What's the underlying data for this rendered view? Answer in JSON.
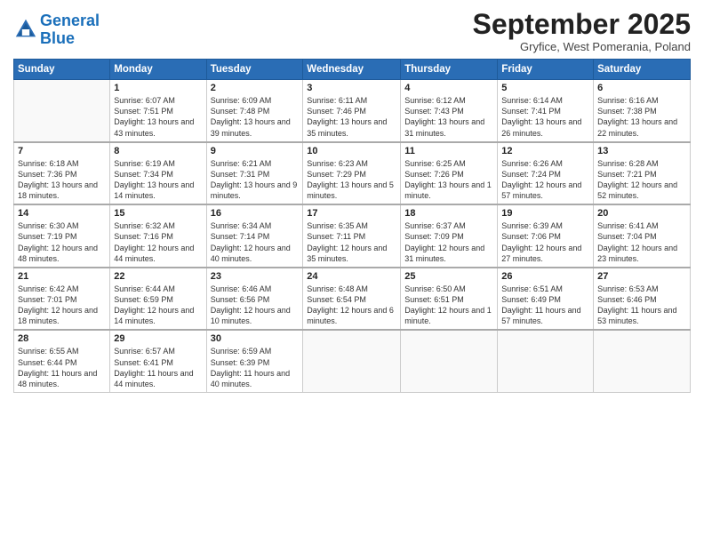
{
  "header": {
    "logo_line1": "General",
    "logo_line2": "Blue",
    "month_title": "September 2025",
    "subtitle": "Gryfice, West Pomerania, Poland"
  },
  "weekdays": [
    "Sunday",
    "Monday",
    "Tuesday",
    "Wednesday",
    "Thursday",
    "Friday",
    "Saturday"
  ],
  "weeks": [
    [
      {
        "day": "",
        "sunrise": "",
        "sunset": "",
        "daylight": "",
        "empty": true
      },
      {
        "day": "1",
        "sunrise": "Sunrise: 6:07 AM",
        "sunset": "Sunset: 7:51 PM",
        "daylight": "Daylight: 13 hours and 43 minutes."
      },
      {
        "day": "2",
        "sunrise": "Sunrise: 6:09 AM",
        "sunset": "Sunset: 7:48 PM",
        "daylight": "Daylight: 13 hours and 39 minutes."
      },
      {
        "day": "3",
        "sunrise": "Sunrise: 6:11 AM",
        "sunset": "Sunset: 7:46 PM",
        "daylight": "Daylight: 13 hours and 35 minutes."
      },
      {
        "day": "4",
        "sunrise": "Sunrise: 6:12 AM",
        "sunset": "Sunset: 7:43 PM",
        "daylight": "Daylight: 13 hours and 31 minutes."
      },
      {
        "day": "5",
        "sunrise": "Sunrise: 6:14 AM",
        "sunset": "Sunset: 7:41 PM",
        "daylight": "Daylight: 13 hours and 26 minutes."
      },
      {
        "day": "6",
        "sunrise": "Sunrise: 6:16 AM",
        "sunset": "Sunset: 7:38 PM",
        "daylight": "Daylight: 13 hours and 22 minutes."
      }
    ],
    [
      {
        "day": "7",
        "sunrise": "Sunrise: 6:18 AM",
        "sunset": "Sunset: 7:36 PM",
        "daylight": "Daylight: 13 hours and 18 minutes."
      },
      {
        "day": "8",
        "sunrise": "Sunrise: 6:19 AM",
        "sunset": "Sunset: 7:34 PM",
        "daylight": "Daylight: 13 hours and 14 minutes."
      },
      {
        "day": "9",
        "sunrise": "Sunrise: 6:21 AM",
        "sunset": "Sunset: 7:31 PM",
        "daylight": "Daylight: 13 hours and 9 minutes."
      },
      {
        "day": "10",
        "sunrise": "Sunrise: 6:23 AM",
        "sunset": "Sunset: 7:29 PM",
        "daylight": "Daylight: 13 hours and 5 minutes."
      },
      {
        "day": "11",
        "sunrise": "Sunrise: 6:25 AM",
        "sunset": "Sunset: 7:26 PM",
        "daylight": "Daylight: 13 hours and 1 minute."
      },
      {
        "day": "12",
        "sunrise": "Sunrise: 6:26 AM",
        "sunset": "Sunset: 7:24 PM",
        "daylight": "Daylight: 12 hours and 57 minutes."
      },
      {
        "day": "13",
        "sunrise": "Sunrise: 6:28 AM",
        "sunset": "Sunset: 7:21 PM",
        "daylight": "Daylight: 12 hours and 52 minutes."
      }
    ],
    [
      {
        "day": "14",
        "sunrise": "Sunrise: 6:30 AM",
        "sunset": "Sunset: 7:19 PM",
        "daylight": "Daylight: 12 hours and 48 minutes."
      },
      {
        "day": "15",
        "sunrise": "Sunrise: 6:32 AM",
        "sunset": "Sunset: 7:16 PM",
        "daylight": "Daylight: 12 hours and 44 minutes."
      },
      {
        "day": "16",
        "sunrise": "Sunrise: 6:34 AM",
        "sunset": "Sunset: 7:14 PM",
        "daylight": "Daylight: 12 hours and 40 minutes."
      },
      {
        "day": "17",
        "sunrise": "Sunrise: 6:35 AM",
        "sunset": "Sunset: 7:11 PM",
        "daylight": "Daylight: 12 hours and 35 minutes."
      },
      {
        "day": "18",
        "sunrise": "Sunrise: 6:37 AM",
        "sunset": "Sunset: 7:09 PM",
        "daylight": "Daylight: 12 hours and 31 minutes."
      },
      {
        "day": "19",
        "sunrise": "Sunrise: 6:39 AM",
        "sunset": "Sunset: 7:06 PM",
        "daylight": "Daylight: 12 hours and 27 minutes."
      },
      {
        "day": "20",
        "sunrise": "Sunrise: 6:41 AM",
        "sunset": "Sunset: 7:04 PM",
        "daylight": "Daylight: 12 hours and 23 minutes."
      }
    ],
    [
      {
        "day": "21",
        "sunrise": "Sunrise: 6:42 AM",
        "sunset": "Sunset: 7:01 PM",
        "daylight": "Daylight: 12 hours and 18 minutes."
      },
      {
        "day": "22",
        "sunrise": "Sunrise: 6:44 AM",
        "sunset": "Sunset: 6:59 PM",
        "daylight": "Daylight: 12 hours and 14 minutes."
      },
      {
        "day": "23",
        "sunrise": "Sunrise: 6:46 AM",
        "sunset": "Sunset: 6:56 PM",
        "daylight": "Daylight: 12 hours and 10 minutes."
      },
      {
        "day": "24",
        "sunrise": "Sunrise: 6:48 AM",
        "sunset": "Sunset: 6:54 PM",
        "daylight": "Daylight: 12 hours and 6 minutes."
      },
      {
        "day": "25",
        "sunrise": "Sunrise: 6:50 AM",
        "sunset": "Sunset: 6:51 PM",
        "daylight": "Daylight: 12 hours and 1 minute."
      },
      {
        "day": "26",
        "sunrise": "Sunrise: 6:51 AM",
        "sunset": "Sunset: 6:49 PM",
        "daylight": "Daylight: 11 hours and 57 minutes."
      },
      {
        "day": "27",
        "sunrise": "Sunrise: 6:53 AM",
        "sunset": "Sunset: 6:46 PM",
        "daylight": "Daylight: 11 hours and 53 minutes."
      }
    ],
    [
      {
        "day": "28",
        "sunrise": "Sunrise: 6:55 AM",
        "sunset": "Sunset: 6:44 PM",
        "daylight": "Daylight: 11 hours and 48 minutes."
      },
      {
        "day": "29",
        "sunrise": "Sunrise: 6:57 AM",
        "sunset": "Sunset: 6:41 PM",
        "daylight": "Daylight: 11 hours and 44 minutes."
      },
      {
        "day": "30",
        "sunrise": "Sunrise: 6:59 AM",
        "sunset": "Sunset: 6:39 PM",
        "daylight": "Daylight: 11 hours and 40 minutes."
      },
      {
        "day": "",
        "sunrise": "",
        "sunset": "",
        "daylight": "",
        "empty": true
      },
      {
        "day": "",
        "sunrise": "",
        "sunset": "",
        "daylight": "",
        "empty": true
      },
      {
        "day": "",
        "sunrise": "",
        "sunset": "",
        "daylight": "",
        "empty": true
      },
      {
        "day": "",
        "sunrise": "",
        "sunset": "",
        "daylight": "",
        "empty": true
      }
    ]
  ]
}
